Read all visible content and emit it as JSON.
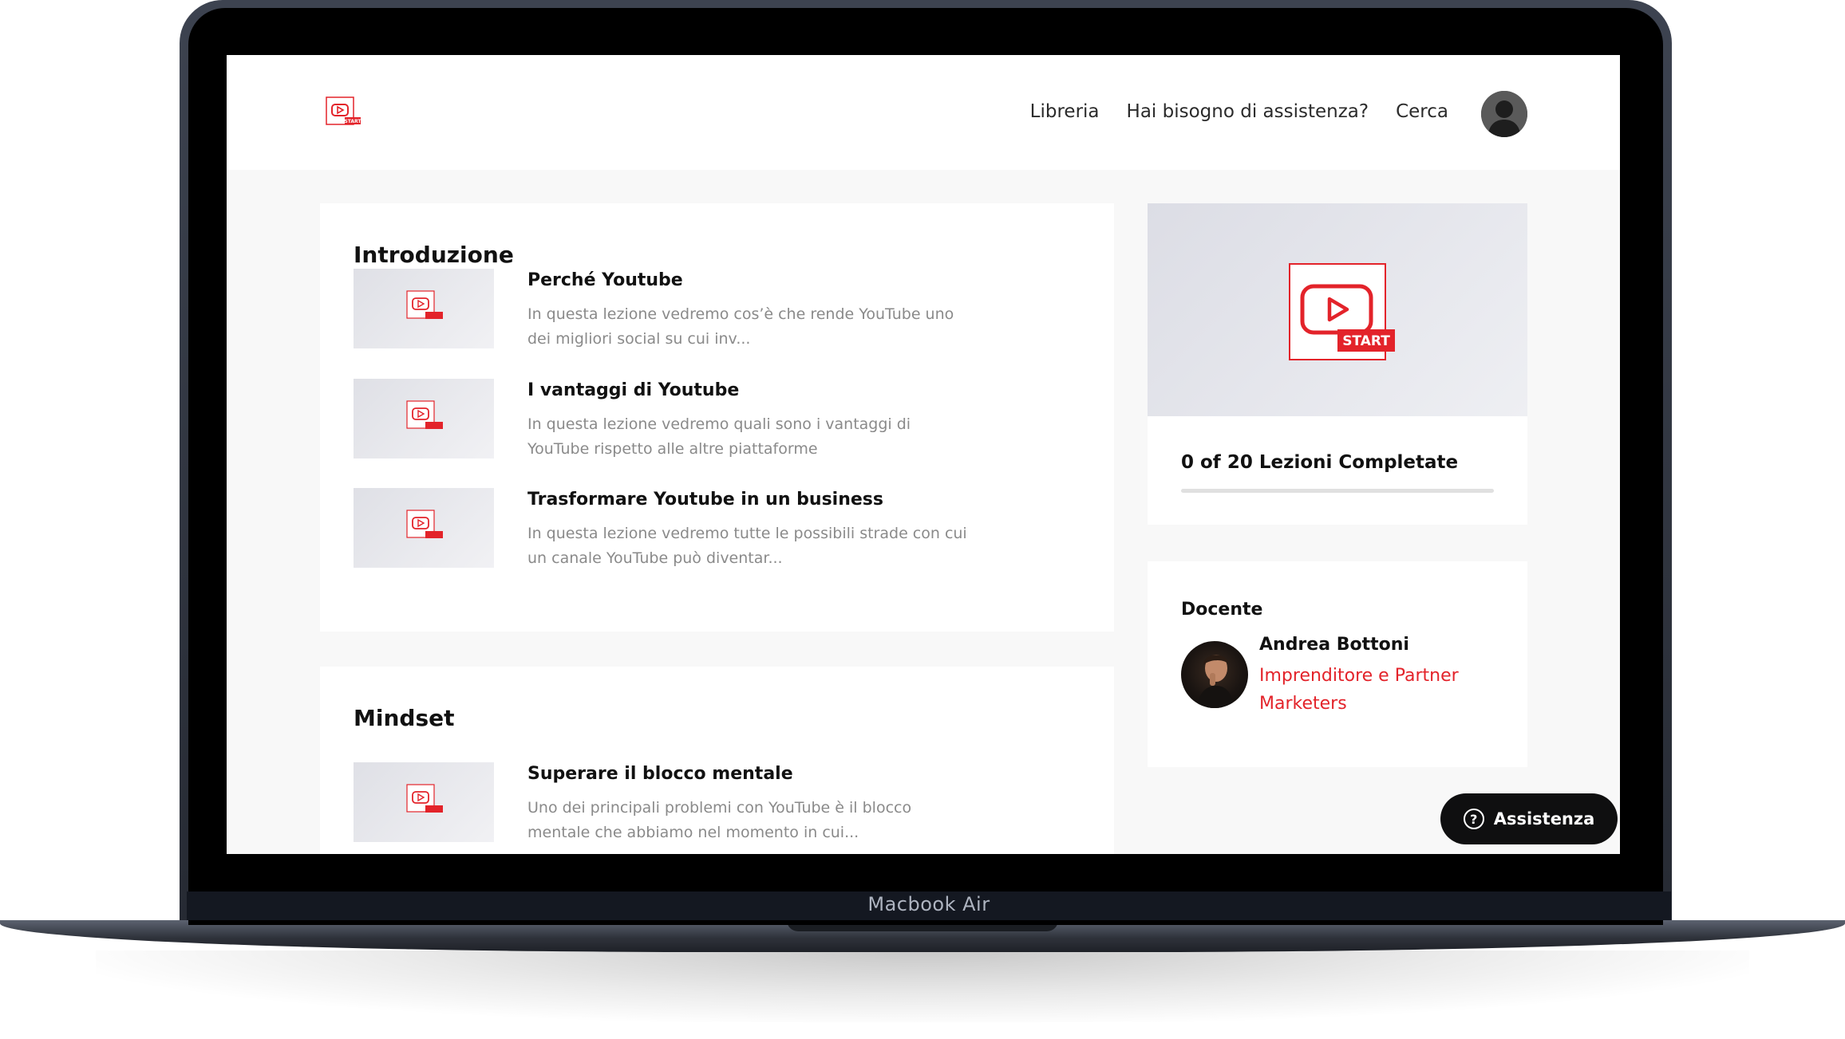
{
  "device": {
    "label": "Macbook Air"
  },
  "header": {
    "nav": [
      "Libreria",
      "Hai bisogno di assistenza?",
      "Cerca"
    ]
  },
  "brand": {
    "logo_text": "START"
  },
  "sections": [
    {
      "title": "Introduzione",
      "lessons": [
        {
          "title": "Perché Youtube",
          "description": "In questa lezione vedremo cos’è che rende YouTube uno dei migliori social su cui inv..."
        },
        {
          "title": "I vantaggi di Youtube",
          "description": "In questa lezione vedremo quali sono i vantaggi di YouTube rispetto alle altre piattaforme"
        },
        {
          "title": "Trasformare Youtube in un business",
          "description": "In questa lezione vedremo tutte le possibili strade con cui un canale YouTube può diventar..."
        }
      ]
    },
    {
      "title": "Mindset",
      "lessons": [
        {
          "title": "Superare il blocco mentale",
          "description": "Uno dei principali problemi con YouTube è il blocco mentale che abbiamo nel momento in cui..."
        }
      ]
    }
  ],
  "progress": {
    "text": "0 of 20 Lezioni Completate",
    "completed": 0,
    "total": 20
  },
  "teacher": {
    "label": "Docente",
    "name": "Andrea Bottoni",
    "role": "Imprenditore e Partner Marketers"
  },
  "help_button": {
    "label": "Assistenza"
  },
  "colors": {
    "accent": "#e3232a",
    "background": "#f8f8f8",
    "dark": "#0f0f10"
  }
}
